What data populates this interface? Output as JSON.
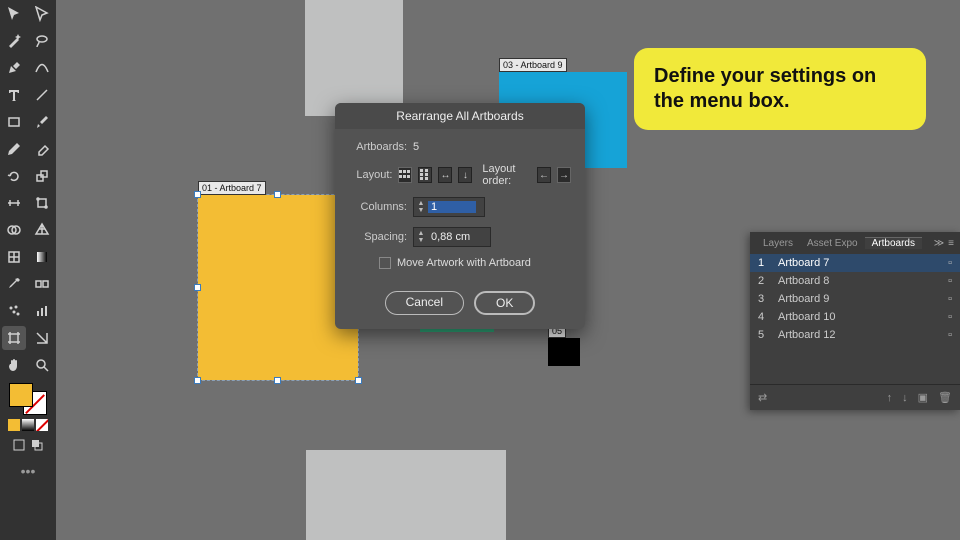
{
  "callout": {
    "text": "Define your settings on the menu box."
  },
  "artboards": {
    "ab7": {
      "label": "01 - Artboard 7"
    },
    "ab9": {
      "label": "03 - Artboard 9"
    },
    "ab_small": {
      "label": "05"
    }
  },
  "dialog": {
    "title": "Rearrange All Artboards",
    "artboards_label": "Artboards:",
    "artboards_count": "5",
    "layout_label": "Layout:",
    "layout_order_label": "Layout order:",
    "columns_label": "Columns:",
    "columns_value": "1",
    "spacing_label": "Spacing:",
    "spacing_value": "0,88 cm",
    "move_label": "Move Artwork with Artboard",
    "cancel": "Cancel",
    "ok": "OK"
  },
  "panel": {
    "tabs": {
      "layers": "Layers",
      "asset": "Asset Expo",
      "artboards": "Artboards"
    },
    "rows": [
      {
        "num": "1",
        "name": "Artboard 7"
      },
      {
        "num": "2",
        "name": "Artboard 8"
      },
      {
        "num": "3",
        "name": "Artboard 9"
      },
      {
        "num": "4",
        "name": "Artboard 10"
      },
      {
        "num": "5",
        "name": "Artboard 12"
      }
    ]
  }
}
